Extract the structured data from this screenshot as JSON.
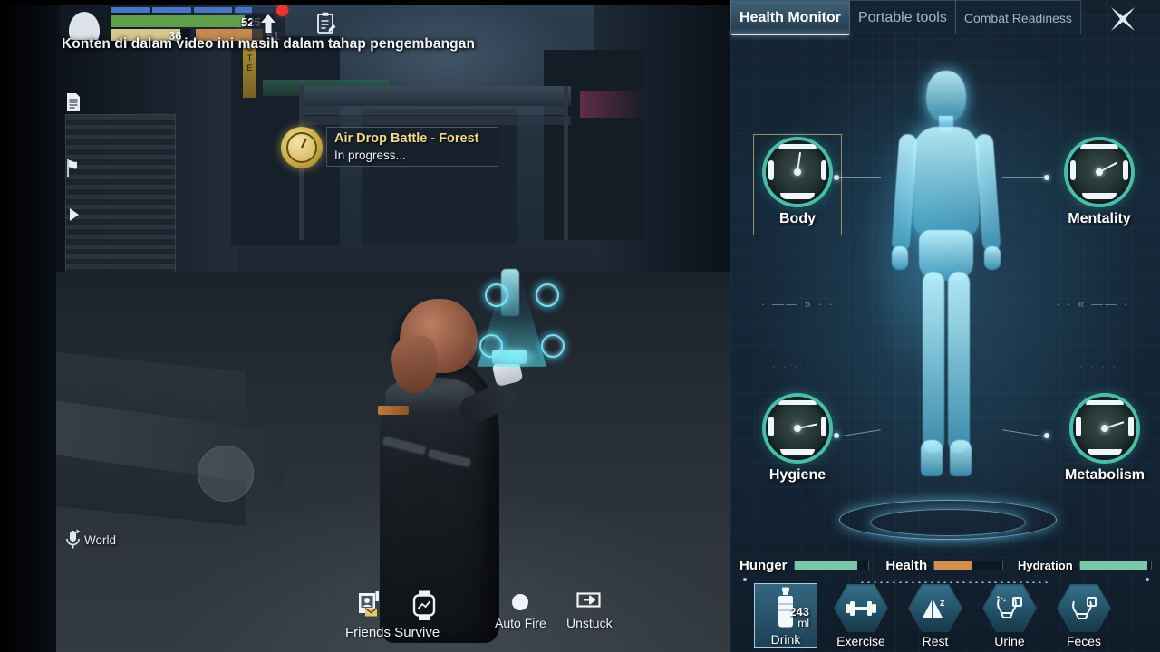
{
  "game": {
    "hud": {
      "avatar_icon": "player-avatar-silhouette",
      "shield_bar_segments": 4,
      "health_value": "525",
      "stamina_value": "36",
      "armor_value": "51",
      "shield_color": "#4a74c8",
      "health_color": "#5f9e4a",
      "stamina_color": "#d8c78f",
      "armor_color": "#c48a52",
      "upgrade_icon": "up-arrow-icon",
      "notes_icon": "clipboard-notes-icon",
      "notification_dot": true
    },
    "caption": "Konten di dalam video ini masih dalam tahap pengembangan",
    "rail": [
      {
        "icon": "document-icon"
      },
      {
        "icon": "flag-icon"
      },
      {
        "icon": "play-triangle-icon"
      }
    ],
    "event_toast": {
      "icon": "stopwatch-icon",
      "title": "Air Drop Battle - Forest",
      "subtitle": "In progress..."
    },
    "voice_chat": {
      "icon": "microphone-icon",
      "label": "World"
    },
    "bottom_buttons": [
      {
        "label": "Friends Survive",
        "icon": "contact-card-envelope-icon"
      },
      {
        "label": "",
        "icon": "smartwatch-icon"
      },
      {
        "label": "Auto Fire",
        "icon": "filled-circle-icon"
      },
      {
        "label": "Unstuck",
        "icon": "exit-arrow-icon"
      }
    ]
  },
  "panel": {
    "tabs": [
      {
        "label": "Health Monitor",
        "active": true
      },
      {
        "label": "Portable tools",
        "active": false
      },
      {
        "label": "Combat Readiness",
        "active": false
      }
    ],
    "close_icon": "close-x-icon",
    "body_figure": "holographic-body-scan",
    "gauges": [
      {
        "id": "body",
        "label": "Body",
        "needle_deg": 8,
        "highlighted": true
      },
      {
        "id": "mentality",
        "label": "Mentality",
        "needle_deg": 62,
        "highlighted": false
      },
      {
        "id": "hygiene",
        "label": "Hygiene",
        "needle_deg": 78,
        "highlighted": false
      },
      {
        "id": "metabolism",
        "label": "Metabolism",
        "needle_deg": 72,
        "highlighted": false
      }
    ],
    "status_bars": [
      {
        "label": "Hunger",
        "percent": 85,
        "color": "#79c8a8"
      },
      {
        "label": "Health",
        "percent": 55,
        "color": "#d2904f"
      },
      {
        "label": "Hydration",
        "percent": 95,
        "color": "#79c8a8"
      }
    ],
    "actions": [
      {
        "label": "Drink",
        "icon": "water-bottle-icon",
        "selected": true,
        "amount": "243",
        "unit": "ml"
      },
      {
        "label": "Exercise",
        "icon": "dumbbell-icon",
        "selected": false
      },
      {
        "label": "Rest",
        "icon": "tent-sleep-icon",
        "selected": false
      },
      {
        "label": "Urine",
        "icon": "toilet-urine-icon",
        "selected": false
      },
      {
        "label": "Feces",
        "icon": "toilet-feces-icon",
        "selected": false
      }
    ],
    "accent_color": "#50d2b9",
    "highlight_color": "#c8af6e"
  }
}
